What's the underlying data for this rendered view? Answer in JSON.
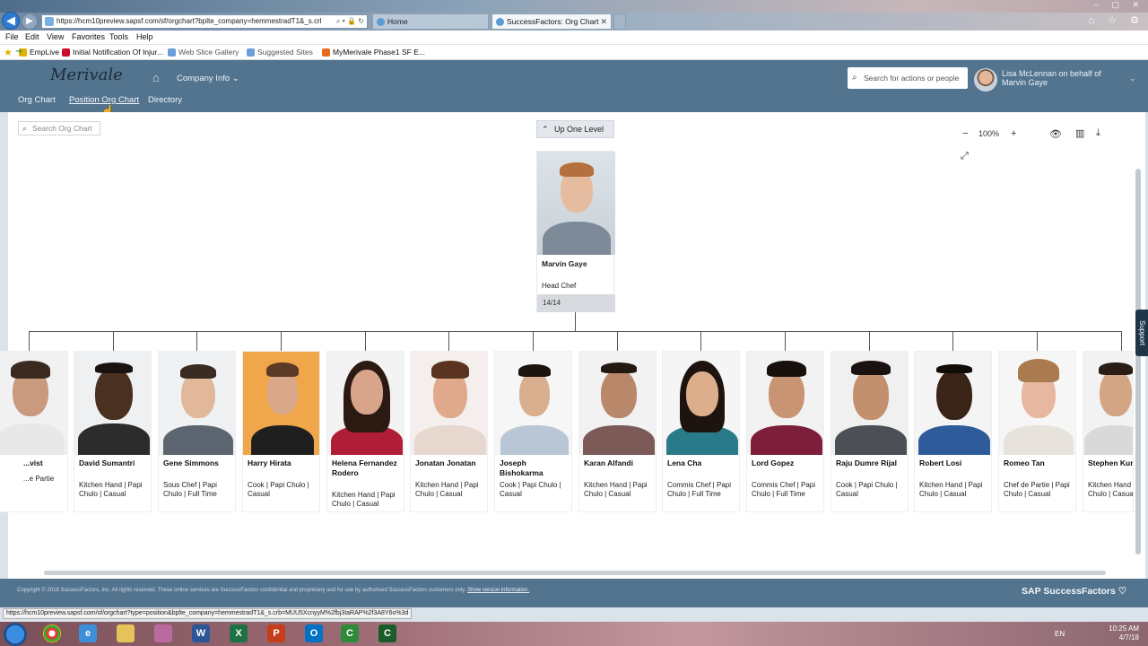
{
  "browser": {
    "url": "https://hcm10preview.sapsf.com/sf/orgchart?bplte_company=hemmestradT1&_s.crl",
    "tabs": [
      {
        "label": "Home"
      },
      {
        "label": "SuccessFactors: Org Chart"
      }
    ],
    "menu": [
      "File",
      "Edit",
      "View",
      "Favorites",
      "Tools",
      "Help"
    ],
    "favorites": [
      "EmpLive",
      "Initial Notification Of Injur...",
      "Web Slice Gallery",
      "Suggested Sites",
      "MyMerivale Phase1 SF E..."
    ],
    "status_url": "https://hcm10preview.sapsf.com/sf/orgchart?type=position&bplte_company=hemmestradT1&_s.crb=MUU5XcnyyM%2fbj3IaRAP%2f3A8Y6o%3d"
  },
  "header": {
    "logo": "Merivale",
    "company_menu": "Company Info",
    "search_placeholder": "Search for actions or people",
    "user_line": "Lisa McLennan on behalf of Marvin Gaye"
  },
  "subnav": [
    "Org Chart",
    "Position Org Chart",
    "Directory"
  ],
  "toolbar": {
    "search_placeholder": "Search Org Chart",
    "up_level": "Up One Level",
    "zoom": "100%"
  },
  "head": {
    "name": "Marvin Gaye",
    "title": "Head Chef",
    "count": "14/14"
  },
  "reports": [
    {
      "name": "...vist",
      "title": "...e Partie"
    },
    {
      "name": "David Sumantri",
      "title": "Kitchen Hand | Papi Chulo | Casual"
    },
    {
      "name": "Gene Simmons",
      "title": "Sous Chef | Papi Chulo | Full Time"
    },
    {
      "name": "Harry Hirata",
      "title": "Cook | Papi Chulo | Casual"
    },
    {
      "name": "Helena Fernandez Rodero",
      "title": "Kitchen Hand | Papi Chulo | Casual"
    },
    {
      "name": "Jonatan Jonatan",
      "title": "Kitchen Hand | Papi Chulo | Casual"
    },
    {
      "name": "Joseph Bishokarma",
      "title": "Cook | Papi Chulo | Casual"
    },
    {
      "name": "Karan Alfandi",
      "title": "Kitchen Hand | Papi Chulo | Casual"
    },
    {
      "name": "Lena Cha",
      "title": "Commis Chef | Papi Chulo | Full Time"
    },
    {
      "name": "Lord Gopez",
      "title": "Commis Chef | Papi Chulo | Full Time"
    },
    {
      "name": "Raju Dumre Rijal",
      "title": "Cook | Papi Chulo | Casual"
    },
    {
      "name": "Robert Losi",
      "title": "Kitchen Hand | Papi Chulo | Casual"
    },
    {
      "name": "Romeo Tan",
      "title": "Chef de Partie | Papi Chulo | Casual"
    },
    {
      "name": "Stephen Kurniawan",
      "title": "Kitchen Hand | Papi Chulo | Casual"
    }
  ],
  "footer": {
    "copyright": "Copyright © 2018 SuccessFactors, Inc. All rights reserved. These online services are SuccessFactors confidential and proprietary and for use by authorised SuccessFactors customers only.",
    "version_link": "Show version information.",
    "brand": "SAP SuccessFactors",
    "support": "Support"
  },
  "taskbar": {
    "lang": "EN",
    "time": "10:25 AM",
    "date": "4/7/18"
  }
}
